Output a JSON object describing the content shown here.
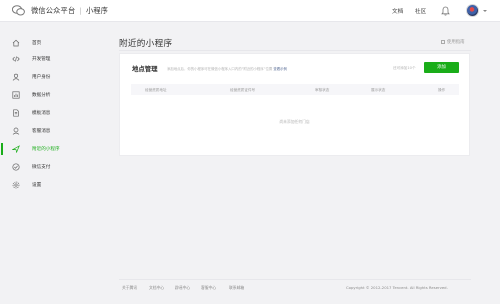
{
  "header": {
    "brand": "微信公众平台",
    "app_name": "小程序",
    "links": [
      "文档",
      "社区"
    ]
  },
  "sidebar": {
    "items": [
      {
        "label": "首页",
        "icon": "home-icon"
      },
      {
        "label": "开发管理",
        "icon": "code-icon"
      },
      {
        "label": "用户身份",
        "icon": "user-icon"
      },
      {
        "label": "数据分析",
        "icon": "chart-icon"
      },
      {
        "label": "模板消息",
        "icon": "document-icon"
      },
      {
        "label": "客服消息",
        "icon": "service-icon"
      },
      {
        "label": "附近的小程序",
        "icon": "location-icon",
        "active": true
      },
      {
        "label": "微信支付",
        "icon": "pay-icon"
      },
      {
        "label": "设置",
        "icon": "gear-icon"
      }
    ]
  },
  "main": {
    "title": "附近的小程序",
    "help_link": "使用指南"
  },
  "card": {
    "title": "地点管理",
    "description": "添加地点后，你的小程序可在微信小程序入口内的“附近的小程序”位置",
    "description_link": "查看示例",
    "remaining": "还可添加10个",
    "add_button": "添加",
    "columns": [
      "经营资质地址",
      "经营资质证件号",
      "审核状态",
      "展示状态",
      "操作"
    ],
    "empty_text": "尚未添加任何门店"
  },
  "footer": {
    "links": [
      "关于腾讯",
      "文档中心",
      "辟谣中心",
      "客服中心",
      "联系邮箱"
    ],
    "copyright": "Copyright © 2012-2017 Tencent. All Rights Reserved."
  },
  "colors": {
    "accent": "#1aad19",
    "background": "#f2f2f4",
    "link": "#576b95"
  }
}
